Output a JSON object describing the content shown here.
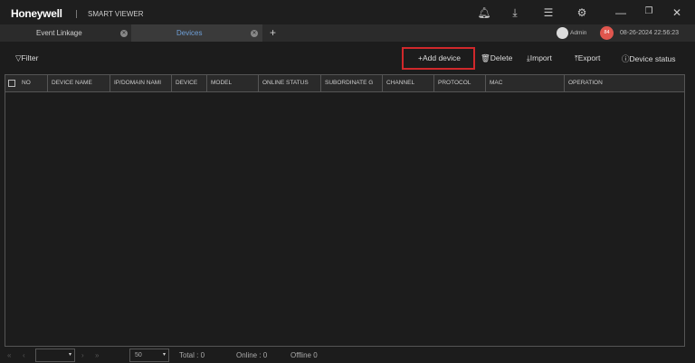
{
  "header": {
    "logo": "Honeywell",
    "app_title": "SMART VIEWER",
    "icons": [
      "bell-icon",
      "download-icon",
      "menu-icon",
      "gear-icon",
      "minimize-icon",
      "restore-icon",
      "close-icon"
    ]
  },
  "tabs": [
    {
      "label": "Event Linkage",
      "active": false
    },
    {
      "label": "Devices",
      "active": true
    }
  ],
  "user": {
    "name": "Admin",
    "badge": "84",
    "datetime": "08-26-2024 22:56:23"
  },
  "toolbar": {
    "filter": "Filter",
    "add": "Add device",
    "delete": "Delete",
    "import": "Import",
    "export": "Export",
    "status": "Device status"
  },
  "table": {
    "columns": [
      "NO",
      "DEVICE NAME",
      "IP/DOMAIN NAMI",
      "DEVICE",
      "MODEL",
      "ONLINE STATUS",
      "SUBORDINATE G",
      "CHANNEL",
      "PROTOCOL",
      "MAC",
      "OPERATION"
    ],
    "rows": []
  },
  "footer": {
    "page": "",
    "page_size": "50",
    "total": "Total : 0",
    "online": "Online : 0",
    "offline": "Offline  0"
  },
  "colors": {
    "accent": "#d0282b",
    "active_tab_text": "#6fa0d8"
  }
}
